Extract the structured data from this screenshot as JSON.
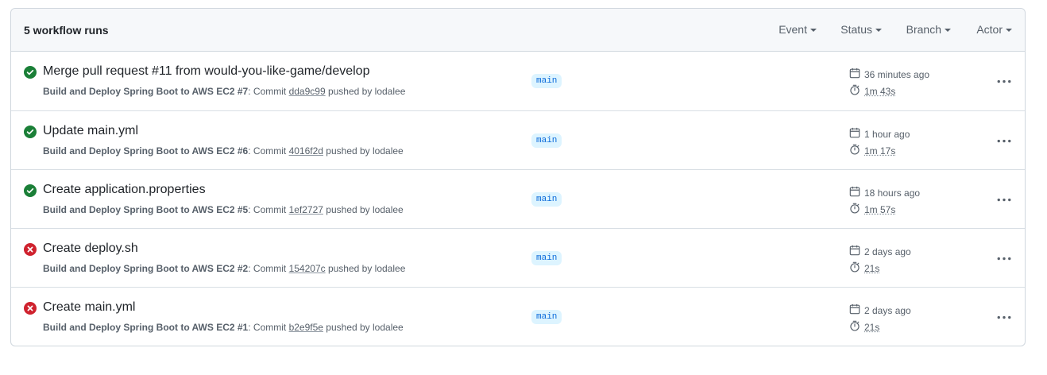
{
  "header": {
    "runs_count": "5 workflow runs",
    "filters": [
      "Event",
      "Status",
      "Branch",
      "Actor"
    ]
  },
  "runs": [
    {
      "status": "success",
      "title": "Merge pull request #11 from would-you-like-game/develop",
      "workflow": "Build and Deploy Spring Boot to AWS EC2 #7",
      "commit_prefix": ": Commit ",
      "sha": "dda9c99",
      "pushed_by": " pushed by lodalee",
      "branch": "main",
      "ago": "36 minutes ago",
      "duration": "1m 43s"
    },
    {
      "status": "success",
      "title": "Update main.yml",
      "workflow": "Build and Deploy Spring Boot to AWS EC2 #6",
      "commit_prefix": ": Commit ",
      "sha": "4016f2d",
      "pushed_by": " pushed by lodalee",
      "branch": "main",
      "ago": "1 hour ago",
      "duration": "1m 17s"
    },
    {
      "status": "success",
      "title": "Create application.properties",
      "workflow": "Build and Deploy Spring Boot to AWS EC2 #5",
      "commit_prefix": ": Commit ",
      "sha": "1ef2727",
      "pushed_by": " pushed by lodalee",
      "branch": "main",
      "ago": "18 hours ago",
      "duration": "1m 57s"
    },
    {
      "status": "failure",
      "title": "Create deploy.sh",
      "workflow": "Build and Deploy Spring Boot to AWS EC2 #2",
      "commit_prefix": ": Commit ",
      "sha": "154207c",
      "pushed_by": " pushed by lodalee",
      "branch": "main",
      "ago": "2 days ago",
      "duration": "21s"
    },
    {
      "status": "failure",
      "title": "Create main.yml",
      "workflow": "Build and Deploy Spring Boot to AWS EC2 #1",
      "commit_prefix": ": Commit ",
      "sha": "b2e9f5e",
      "pushed_by": " pushed by lodalee",
      "branch": "main",
      "ago": "2 days ago",
      "duration": "21s"
    }
  ],
  "colors": {
    "success": "#1a7f37",
    "failure": "#cf222e",
    "branch_bg": "#ddf4ff",
    "branch_fg": "#0969da"
  },
  "icons": {
    "success": "check-circle-fill-icon",
    "failure": "x-circle-fill-icon",
    "date": "calendar-icon",
    "duration": "stopwatch-icon",
    "more": "kebab-horizontal-icon"
  }
}
